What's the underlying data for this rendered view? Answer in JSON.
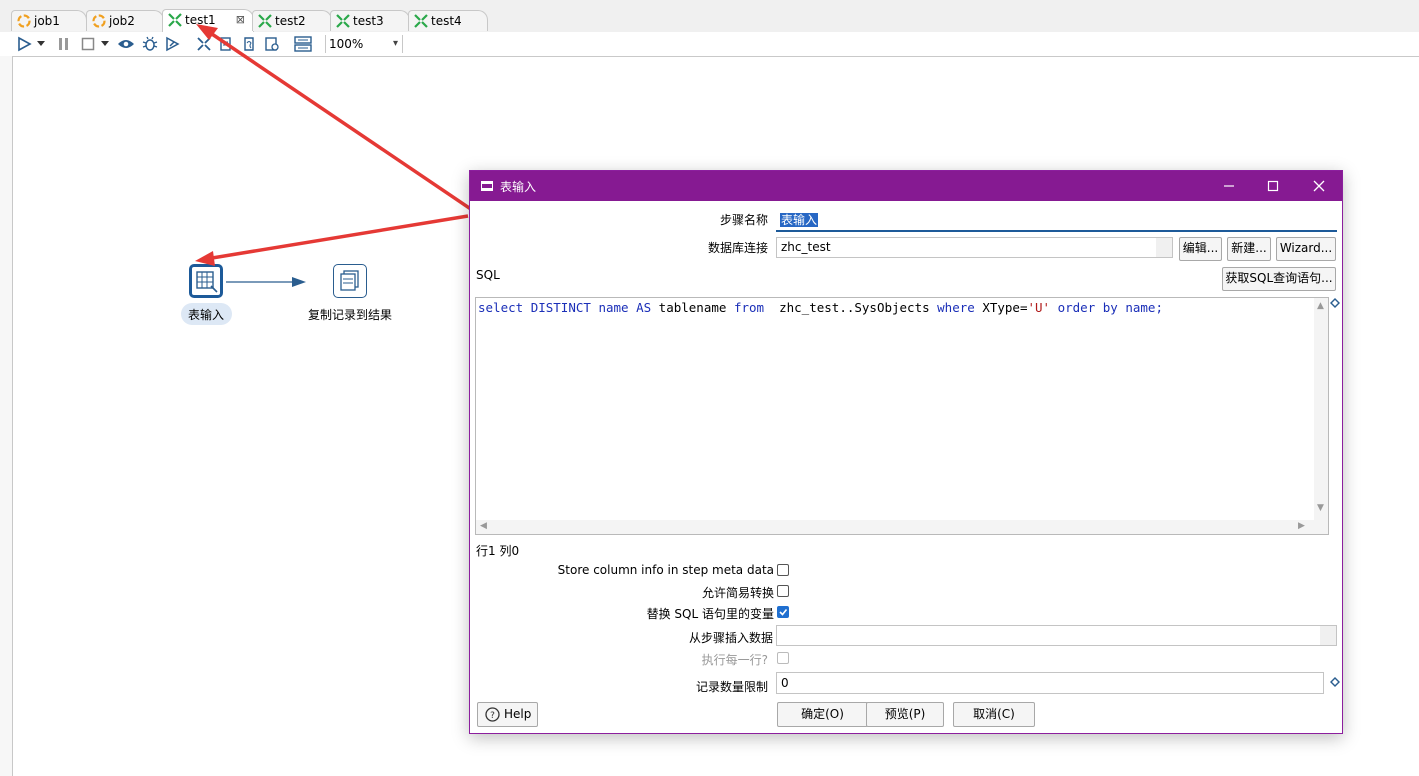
{
  "tabs": [
    {
      "label": "job1",
      "type": "job"
    },
    {
      "label": "job2",
      "type": "job"
    },
    {
      "label": "test1",
      "type": "trans",
      "active": true
    },
    {
      "label": "test2",
      "type": "trans"
    },
    {
      "label": "test3",
      "type": "trans"
    },
    {
      "label": "test4",
      "type": "trans"
    }
  ],
  "toolbar": {
    "zoom": "100%"
  },
  "canvas": {
    "step1_label": "表输入",
    "step2_label": "复制记录到结果"
  },
  "dialog": {
    "title": "表输入",
    "step_name_label": "步骤名称",
    "step_name_value": "表输入",
    "db_conn_label": "数据库连接",
    "db_conn_value": "zhc_test",
    "edit_btn": "编辑...",
    "new_btn": "新建...",
    "wizard_btn": "Wizard...",
    "sql_label": "SQL",
    "get_sql_btn": "获取SQL查询语句...",
    "sql_text": {
      "kw_select": "select",
      "kw_distinct": "DISTINCT",
      "col_name": "name",
      "kw_as": "AS",
      "alias": "tablename",
      "kw_from": "from",
      "table": "zhc_test..SysObjects",
      "kw_where": "where",
      "cond": "XType=",
      "literal": "'U'",
      "kw_order": "order",
      "kw_by": "by",
      "order_col": "name;"
    },
    "cursor_pos": "行1 列0",
    "store_column_label": "Store column info in step meta data",
    "lazy_conv_label": "允许简易转换",
    "replace_var_label": "替换 SQL 语句里的变量",
    "insert_from_step_label": "从步骤插入数据",
    "insert_from_step_value": "",
    "exec_each_row_label": "执行每一行?",
    "limit_label": "记录数量限制",
    "limit_value": "0",
    "help_btn": "Help",
    "ok_btn": "确定(O)",
    "preview_btn": "预览(P)",
    "cancel_btn": "取消(C)"
  },
  "colors": {
    "dialog_title": "#861a92",
    "step_border": "#2a5d8f",
    "arrow": "#e53935"
  }
}
